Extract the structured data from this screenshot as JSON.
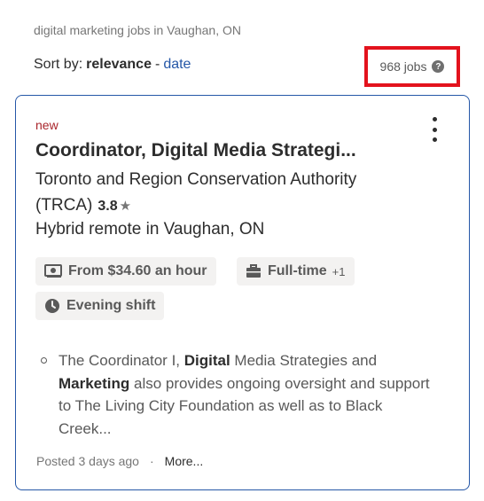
{
  "search": {
    "query": "digital marketing jobs in Vaughan, ON"
  },
  "sort": {
    "label": "Sort by:",
    "active": "relevance",
    "separator": "-",
    "alt": "date"
  },
  "results": {
    "count": "968 jobs",
    "help_icon": "question-circle-icon",
    "highlight_color": "#e3121d"
  },
  "job": {
    "badge": "new",
    "title": "Coordinator, Digital Media Strategi...",
    "company_line1": "Toronto and Region Conservation Authority",
    "company_line2": "(TRCA)",
    "rating": "3.8",
    "rating_icon": "star-icon",
    "location": "Hybrid remote in Vaughan, ON",
    "tags": {
      "salary": "From $34.60 an hour",
      "type": "Full-time",
      "type_extra": "+1",
      "shift": "Evening shift"
    },
    "snippet": {
      "p1": "The Coordinator I, ",
      "b1": "Digital",
      "p2": " Media Strategies and ",
      "b2": "Marketing",
      "p3": " also provides ongoing oversight and support to The Living City Foundation as well as to Black Creek..."
    },
    "posted": "Posted 3 days ago",
    "footer_dot": "·",
    "more": "More..."
  },
  "colors": {
    "link": "#2557a7",
    "card_border": "#2557a7",
    "new_badge": "#a9252b"
  }
}
